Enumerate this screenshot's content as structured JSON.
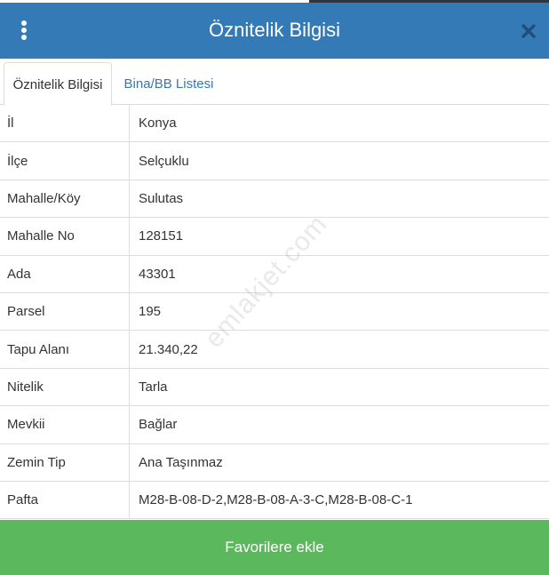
{
  "header": {
    "title": "Öznitelik Bilgisi",
    "menu_icon": "kebab-menu-icon",
    "close_icon": "close-icon",
    "color": "#337ab7"
  },
  "tabs": [
    {
      "label": "Öznitelik Bilgisi",
      "active": true
    },
    {
      "label": "Bina/BB Listesi",
      "active": false
    }
  ],
  "attributes": [
    {
      "label": "İl",
      "value": "Konya"
    },
    {
      "label": "İlçe",
      "value": "Selçuklu"
    },
    {
      "label": "Mahalle/Köy",
      "value": "Sulutas"
    },
    {
      "label": "Mahalle No",
      "value": "128151"
    },
    {
      "label": "Ada",
      "value": "43301"
    },
    {
      "label": "Parsel",
      "value": "195"
    },
    {
      "label": "Tapu Alanı",
      "value": "21.340,22"
    },
    {
      "label": "Nitelik",
      "value": "Tarla"
    },
    {
      "label": "Mevkii",
      "value": "Bağlar"
    },
    {
      "label": "Zemin Tip",
      "value": "Ana Taşınmaz"
    },
    {
      "label": "Pafta",
      "value": "M28-B-08-D-2,M28-B-08-A-3-C,M28-B-08-C-1"
    }
  ],
  "watermark": "emlakjet.com",
  "footer": {
    "button_label": "Favorilere ekle",
    "color": "#5cb85c"
  }
}
